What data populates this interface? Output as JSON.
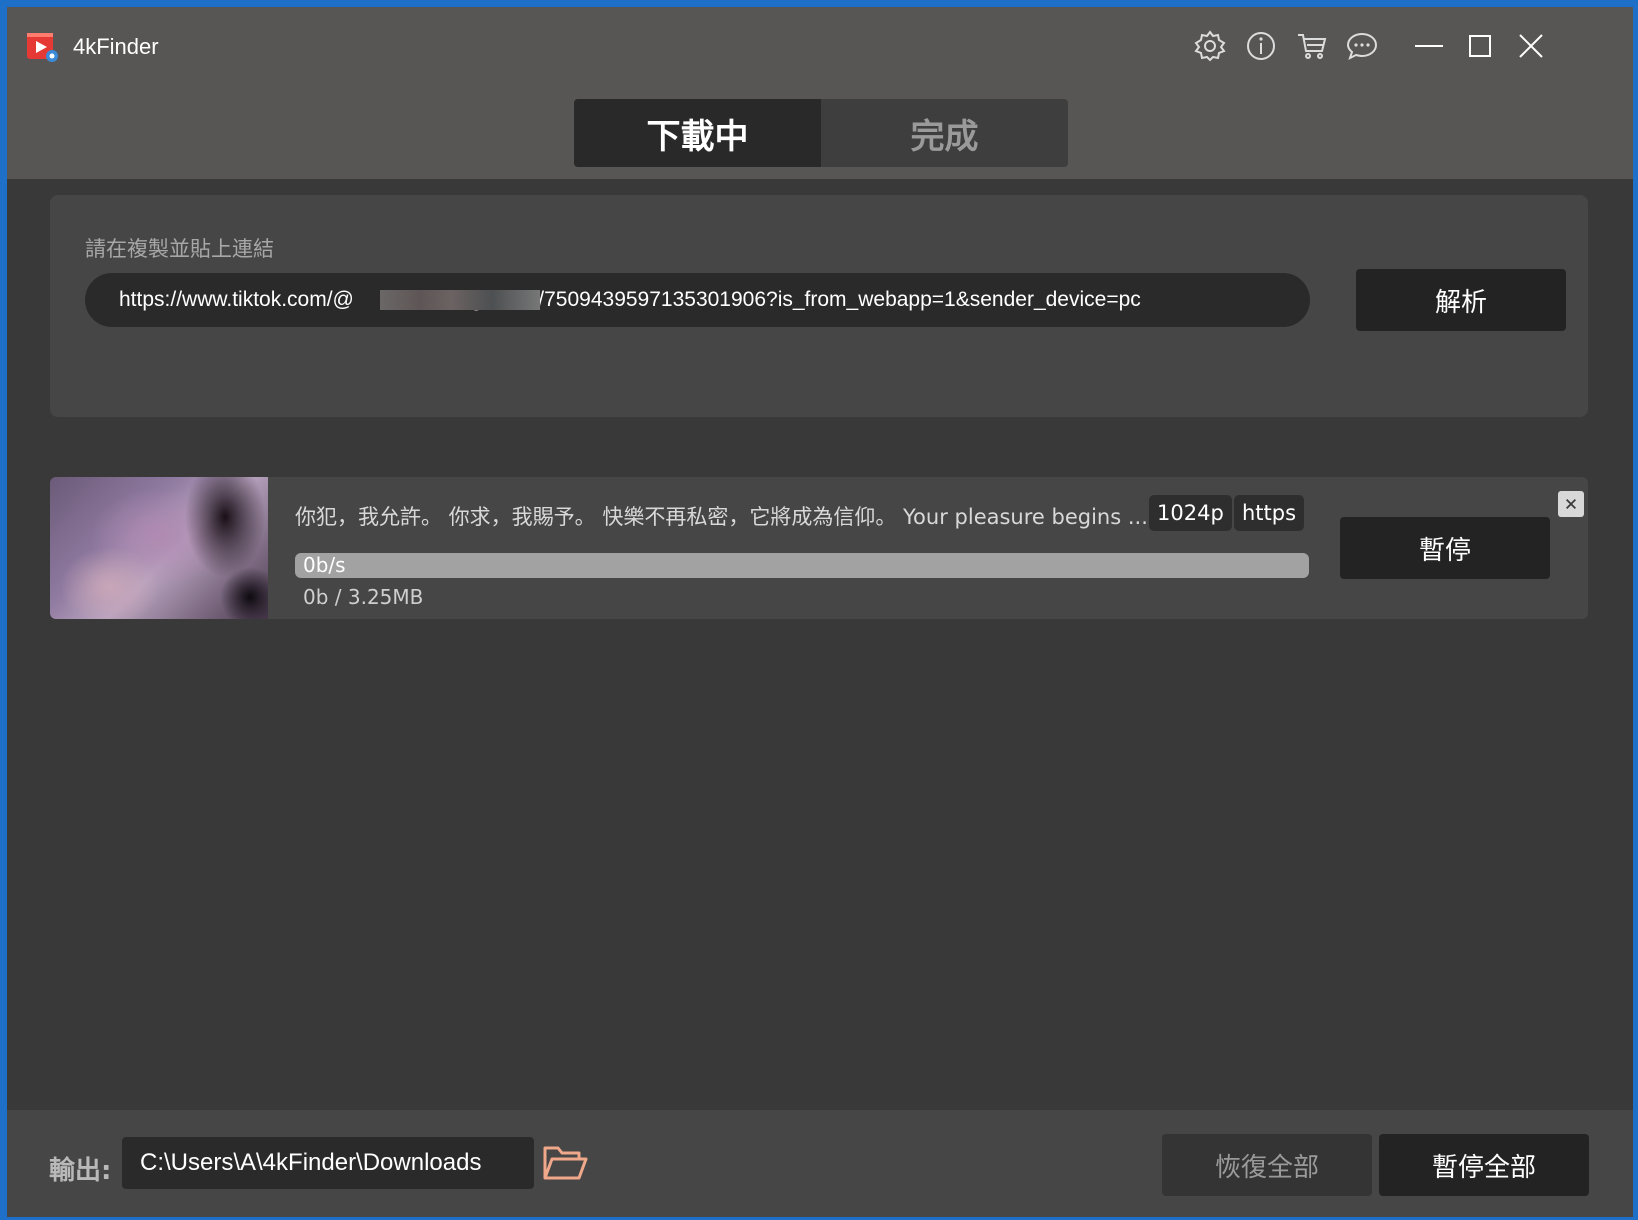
{
  "app": {
    "title": "4kFinder",
    "logo_icon": "video-play-logo-icon",
    "header_icons": [
      "gear-icon",
      "info-icon",
      "cart-icon",
      "chat-icon"
    ],
    "window_controls": [
      "minimize-icon",
      "maximize-icon",
      "close-icon"
    ]
  },
  "tabs": [
    {
      "label": "下載中",
      "active": true
    },
    {
      "label": "完成",
      "active": false
    }
  ],
  "link_panel": {
    "hint": "請在複製並貼上連結",
    "url_value": "https://www.tiktok.com/@                    g/video/7509439597135301906?is_from_webapp=1&sender_device=pc",
    "parse_label": "解析"
  },
  "task": {
    "title": "你犯，我允許。 你求，我賜予。 快樂不再私密，它將成為信仰。 Your pleasure begins ...",
    "resolution": "1024p",
    "protocol": "https",
    "speed": "0b/s",
    "size": "0b / 3.25MB",
    "progress_fraction": 0,
    "pause_label": "暫停",
    "close_icon": "close-icon"
  },
  "footer": {
    "output_label": "輸出:",
    "output_path": "C:\\Users\\A\\4kFinder\\Downloads",
    "folder_icon": "folder-open-icon",
    "resume_all_label": "恢復全部",
    "pause_all_label": "暫停全部"
  },
  "colors": {
    "background": "#3a3939",
    "header": "#575655",
    "panel": "#474646",
    "button_dark": "#232323",
    "folder_accent": "#f0a88a",
    "logo_red": "#e53935"
  }
}
